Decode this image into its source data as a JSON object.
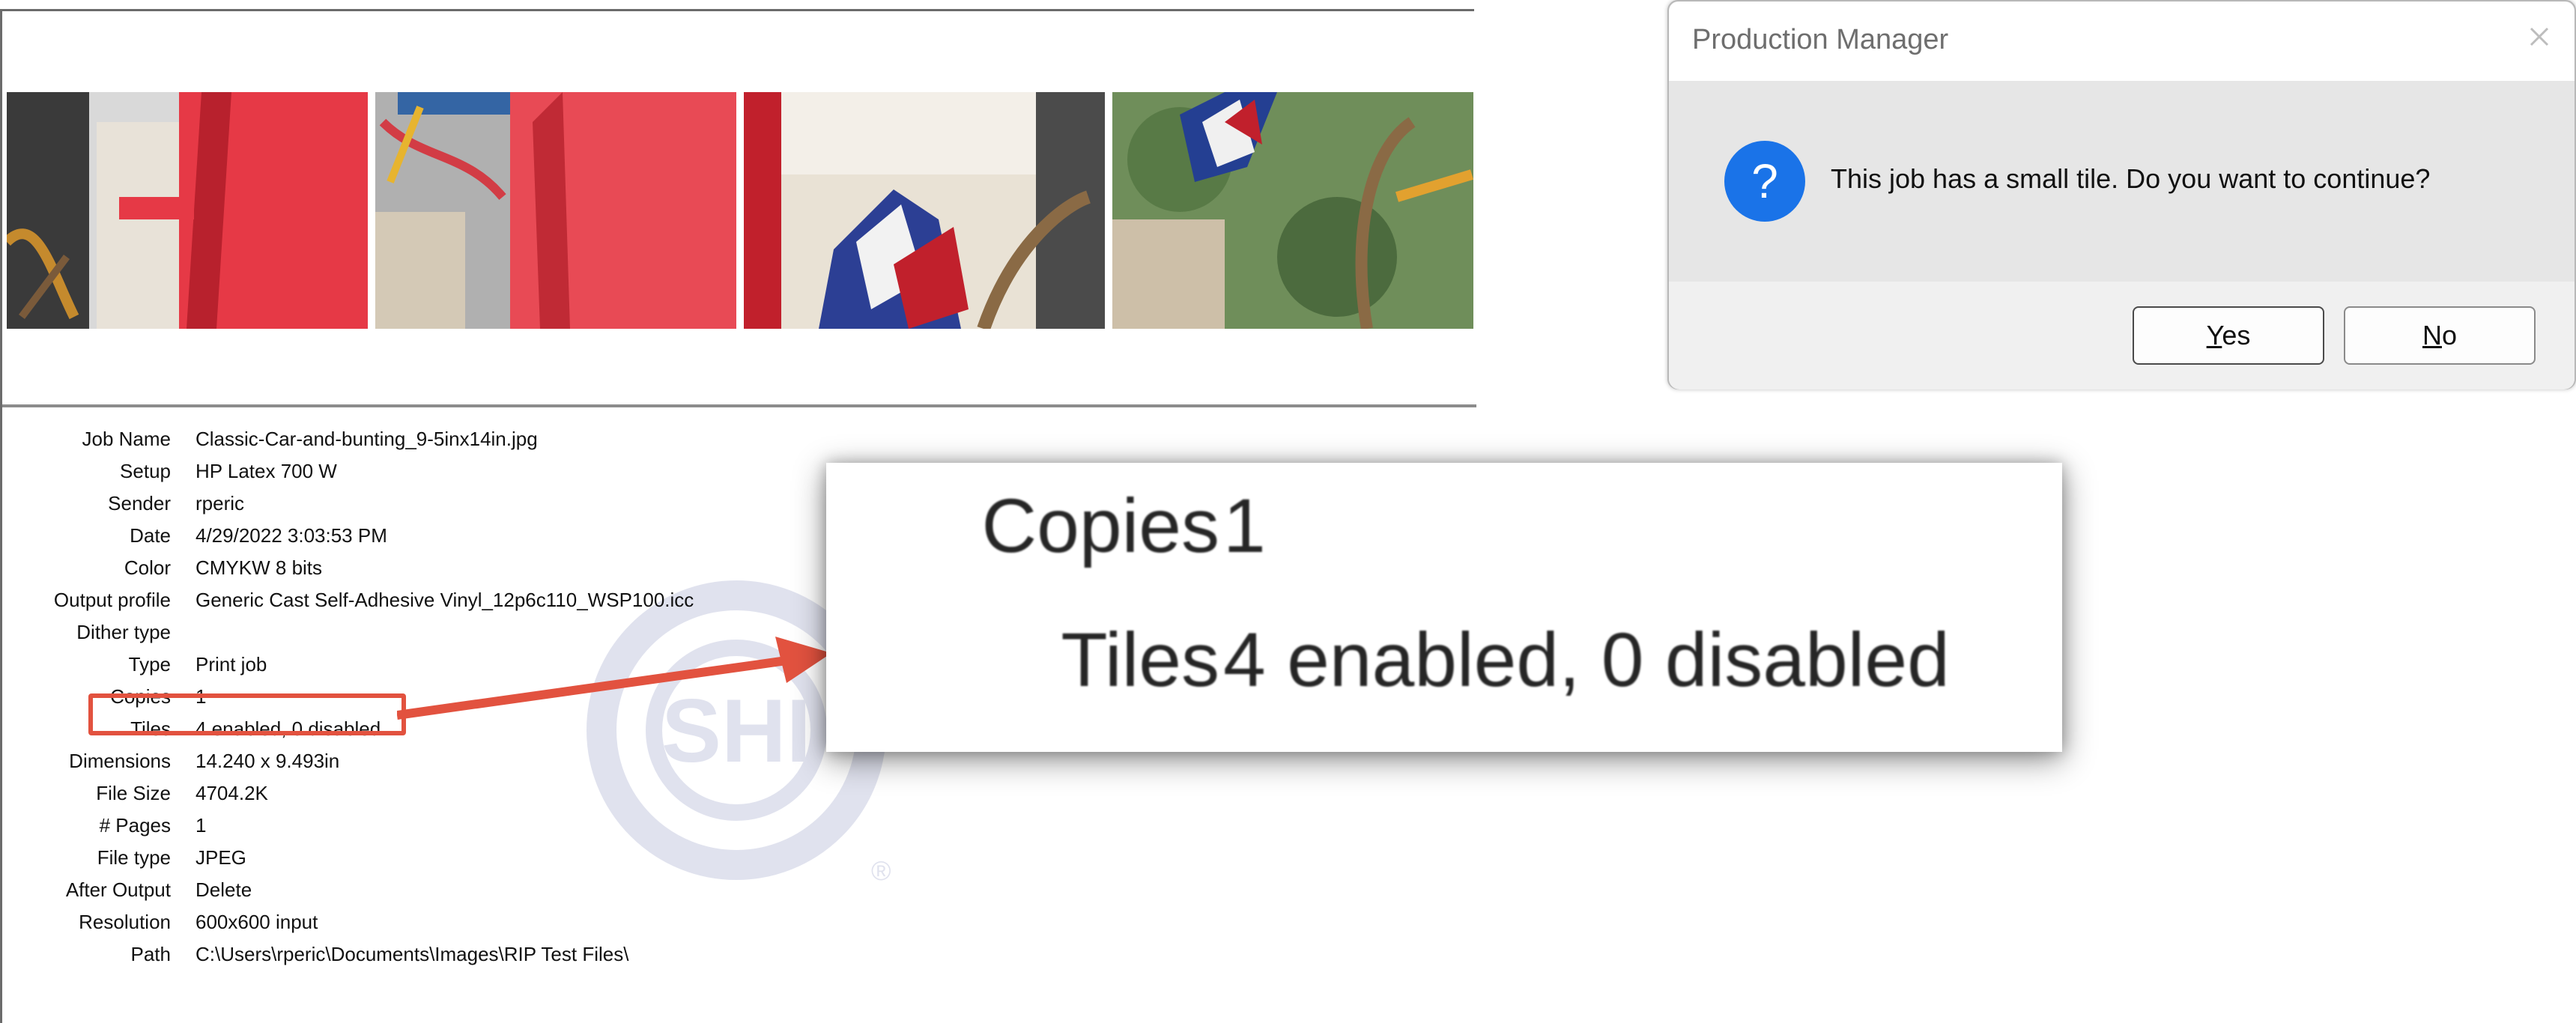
{
  "job_properties": [
    {
      "label": "Job Name",
      "value": "Classic-Car-and-bunting_9-5inx14in.jpg"
    },
    {
      "label": "Setup",
      "value": "HP Latex 700 W"
    },
    {
      "label": "Sender",
      "value": "rperic"
    },
    {
      "label": "Date",
      "value": "4/29/2022 3:03:53 PM"
    },
    {
      "label": "Color",
      "value": "CMYKW 8 bits"
    },
    {
      "label": "Output profile",
      "value": "Generic Cast Self-Adhesive Vinyl_12p6c110_WSP100.icc"
    },
    {
      "label": "Dither type",
      "value": ""
    },
    {
      "label": "Type",
      "value": "Print job"
    },
    {
      "label": "Copies",
      "value": "1"
    },
    {
      "label": "Tiles",
      "value": "4 enabled, 0 disabled"
    },
    {
      "label": "Dimensions",
      "value": "14.240 x 9.493in"
    },
    {
      "label": "File Size",
      "value": "4704.2K"
    },
    {
      "label": "# Pages",
      "value": "1"
    },
    {
      "label": "File type",
      "value": "JPEG"
    },
    {
      "label": "After Output",
      "value": "Delete"
    },
    {
      "label": "Resolution",
      "value": "600x600 input"
    },
    {
      "label": "Path",
      "value": "C:\\Users\\rperic\\Documents\\Images\\RIP Test Files\\"
    }
  ],
  "zoom_callout": {
    "copies_label": "Copies",
    "copies_value": "1",
    "tiles_label": "Tiles",
    "tiles_value": "4 enabled, 0 disabled"
  },
  "watermark": {
    "text": "SHI",
    "mark": "®"
  },
  "dialog": {
    "title": "Production Manager",
    "message": "This job has a small tile. Do you want to continue?",
    "yes_mnemonic": "Y",
    "yes_rest": "es",
    "no_mnemonic": "N",
    "no_rest": "o"
  },
  "colors": {
    "highlight": "#e2523f",
    "question_icon": "#1a73e8"
  }
}
